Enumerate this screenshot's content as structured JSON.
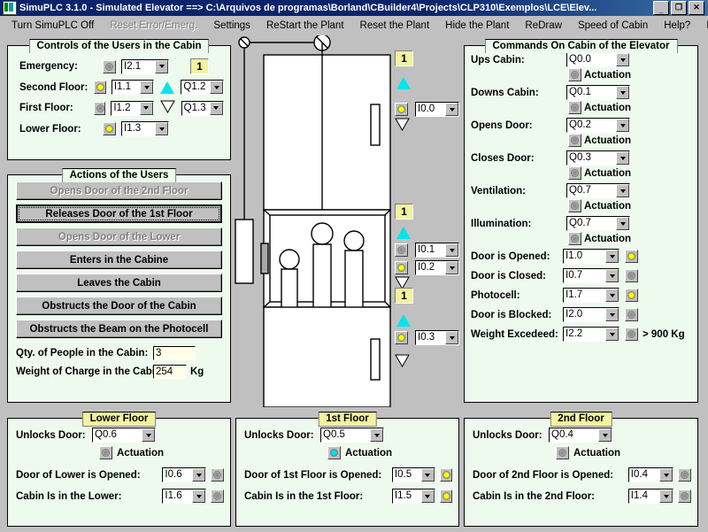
{
  "window": {
    "title": "SimuPLC 3.1.0 - Simulated Elevator ==> C:\\Arquivos de programas\\Borland\\CBuilder4\\Projects\\CLP310\\Exemplos\\LCE\\Elev...",
    "minimize": "_",
    "restore": "❐",
    "close": "✕"
  },
  "menu": [
    {
      "label": "Turn SimuPLC Off",
      "disabled": false
    },
    {
      "label": "Reset Error/Emerg.",
      "disabled": true
    },
    {
      "label": "Settings",
      "disabled": false
    },
    {
      "label": "ReStart the Plant",
      "disabled": false
    },
    {
      "label": "Reset the Plant",
      "disabled": false
    },
    {
      "label": "Hide the Plant",
      "disabled": false
    },
    {
      "label": "ReDraw",
      "disabled": false
    },
    {
      "label": "Speed of Cabin",
      "disabled": false
    },
    {
      "label": "Help?",
      "disabled": false
    },
    {
      "label": "Português",
      "disabled": false
    }
  ],
  "controls_panel": {
    "title": "Controls of the Users in the Cabin",
    "rows": [
      {
        "label": "Emergency:",
        "led": "off",
        "combo": "I2.1",
        "display": "1"
      },
      {
        "label": "Second Floor:",
        "led": "on",
        "combo": "I1.1",
        "arrow": "up",
        "combo2": "Q1.2"
      },
      {
        "label": "First Floor:",
        "led": "off",
        "combo": "I1.2",
        "arrow": "down",
        "combo2": "Q1.3"
      },
      {
        "label": "Lower Floor:",
        "led": "on",
        "combo": "I1.3"
      }
    ]
  },
  "actions_panel": {
    "title": "Actions of the Users",
    "buttons": [
      {
        "label": "Opens Door of the 2nd Floor",
        "state": "disabled"
      },
      {
        "label": "Releases Door of the 1st Floor",
        "state": "focused"
      },
      {
        "label": "Opens Door of the Lower",
        "state": "disabled"
      },
      {
        "label": "Enters in the Cabine",
        "state": "normal"
      },
      {
        "label": "Leaves the Cabin",
        "state": "normal"
      },
      {
        "label": "Obstructs the Door of the Cabin",
        "state": "normal"
      },
      {
        "label": "Obstructs the Beam on the Photocell",
        "state": "normal"
      }
    ],
    "qty_label": "Qty. of People in the Cabin:",
    "qty_value": "3",
    "weight_label": "Weight of Charge in the Cabin:",
    "weight_value": "254",
    "weight_unit": "Kg"
  },
  "plant": {
    "indicators": [
      {
        "display": "1",
        "up": true,
        "led": "on",
        "combo": "I0.0",
        "down": true
      },
      {
        "display": "1",
        "up": true,
        "led": "off",
        "combo": "I0.1",
        "led2": "on",
        "combo2": "I0.2",
        "down": true
      },
      {
        "display": "1",
        "up": true,
        "led": "on",
        "combo": "I0.3",
        "down": true
      }
    ],
    "people_in_cabin": 3
  },
  "commands_panel": {
    "title": "Commands On Cabin of the Elevator",
    "actuation_label": "Actuation",
    "outputs": [
      {
        "label": "Ups Cabin:",
        "combo": "Q0.0",
        "led": "off"
      },
      {
        "label": "Downs Cabin:",
        "combo": "Q0.1",
        "led": "off"
      },
      {
        "label": "Opens Door:",
        "combo": "Q0.2",
        "led": "off"
      },
      {
        "label": "Closes Door:",
        "combo": "Q0.3",
        "led": "off"
      },
      {
        "label": "Ventilation:",
        "combo": "Q0.7",
        "led": "off"
      },
      {
        "label": "Illumination:",
        "combo": "Q0.7",
        "led": "off"
      }
    ],
    "inputs": [
      {
        "label": "Door is Opened:",
        "combo": "I1.0",
        "led": "on"
      },
      {
        "label": "Door is Closed:",
        "combo": "I0.7",
        "led": "off"
      },
      {
        "label": "Photocell:",
        "combo": "I1.7",
        "led": "on"
      },
      {
        "label": "Door is Blocked:",
        "combo": "I2.0",
        "led": "off"
      },
      {
        "label": "Weight Excedeed:",
        "combo": "I2.2",
        "led": "off",
        "suffix": "> 900 Kg"
      }
    ]
  },
  "floor_panels": [
    {
      "title": "Lower Floor",
      "unlock_label": "Unlocks Door:",
      "unlock_combo": "Q0.6",
      "actuation_label": "Actuation",
      "actuation_led": "off",
      "door_label": "Door of Lower is Opened:",
      "door_combo": "I0.6",
      "door_led": "off",
      "cabin_label": "Cabin Is in the Lower:",
      "cabin_combo": "I1.6",
      "cabin_led": "off"
    },
    {
      "title": "1st Floor",
      "unlock_label": "Unlocks Door:",
      "unlock_combo": "Q0.5",
      "actuation_label": "Actuation",
      "actuation_led": "cyan",
      "door_label": "Door of 1st Floor is Opened:",
      "door_combo": "I0.5",
      "door_led": "on",
      "cabin_label": "Cabin Is in the 1st Floor:",
      "cabin_combo": "I1.5",
      "cabin_led": "on"
    },
    {
      "title": "2nd Floor",
      "unlock_label": "Unlocks Door:",
      "unlock_combo": "Q0.4",
      "actuation_label": "Actuation",
      "actuation_led": "off",
      "door_label": "Door of 2nd Floor is Opened:",
      "door_combo": "I0.4",
      "door_led": "off",
      "cabin_label": "Cabin Is in the 2nd Floor:",
      "cabin_combo": "I1.4",
      "cabin_led": "off"
    }
  ],
  "colors": {
    "panel_bg": "#eefaee",
    "caption_yellow": "#f2f2a0",
    "led_on": "#ffff00",
    "led_cyan": "#00e5ee",
    "titlebar": "#0a246a",
    "face": "#c0c0c0"
  }
}
